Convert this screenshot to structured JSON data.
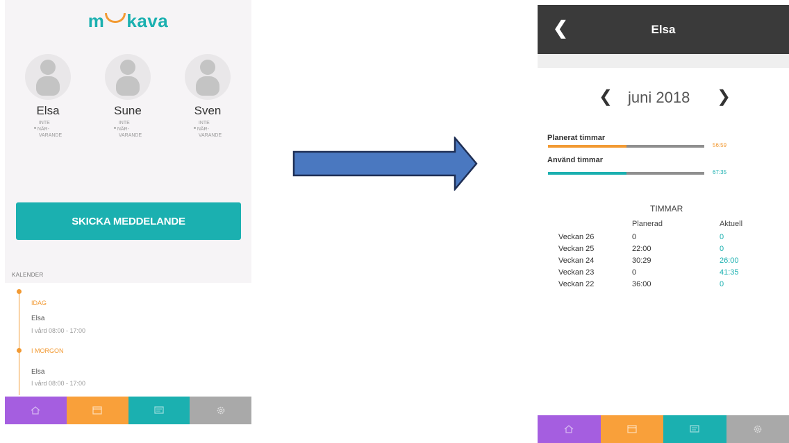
{
  "left": {
    "logo": {
      "m": "m",
      "rest": "kava"
    },
    "persons": [
      {
        "name": "Elsa",
        "status": [
          "INTE",
          "NÄR-",
          "VARANDE"
        ]
      },
      {
        "name": "Sune",
        "status": [
          "INTE",
          "NÄR-",
          "VARANDE"
        ]
      },
      {
        "name": "Sven",
        "status": [
          "INTE",
          "NÄR-",
          "VARANDE"
        ]
      }
    ],
    "send_button": "SKICKA MEDDELANDE",
    "kalender_title": "KALENDER",
    "calendar": [
      {
        "day": "IDAG",
        "name": "Elsa",
        "time": "I vård 08:00 - 17:00"
      },
      {
        "day": "I MORGON",
        "name": "Elsa",
        "time": "I vård 08:00 - 17:00"
      }
    ]
  },
  "right": {
    "title": "Elsa",
    "back_icon": "chevron-left-icon",
    "month": "juni 2018",
    "planned": {
      "label": "Planerat timmar",
      "value": "56:59",
      "fill_fraction": 0.5,
      "color": "#f29a33"
    },
    "used": {
      "label": "Använd timmar",
      "value": "67:35",
      "fill_fraction": 0.5,
      "color": "#1bb0b0"
    },
    "table": {
      "heading": "TIMMAR",
      "columns": [
        "Planerad",
        "Aktuell"
      ],
      "rows": [
        {
          "week": "Veckan 26",
          "planned": "0",
          "actual": "0"
        },
        {
          "week": "Veckan 25",
          "planned": "22:00",
          "actual": "0"
        },
        {
          "week": "Veckan 24",
          "planned": "30:29",
          "actual": "26:00"
        },
        {
          "week": "Veckan 23",
          "planned": "0",
          "actual": "41:35"
        },
        {
          "week": "Veckan 22",
          "planned": "36:00",
          "actual": "0"
        }
      ]
    }
  },
  "tabbar": [
    {
      "icon": "home-icon",
      "color": "#a55ee0"
    },
    {
      "icon": "calendar-icon",
      "color": "#f9a03a"
    },
    {
      "icon": "message-icon",
      "color": "#1bb0b0"
    },
    {
      "icon": "gear-icon",
      "color": "#a9a9a9"
    }
  ]
}
